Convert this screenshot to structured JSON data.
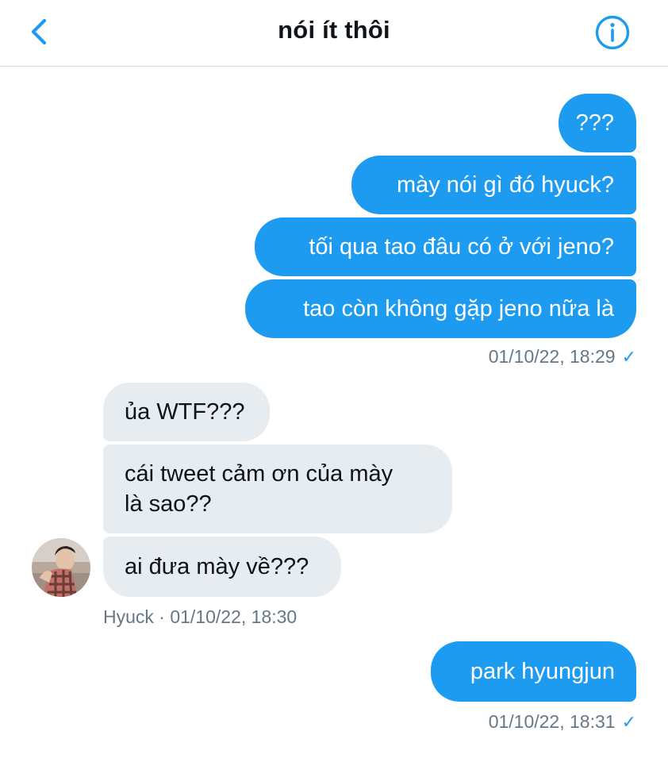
{
  "header": {
    "title": "nói ít thôi",
    "back_icon": "chevron-left-icon",
    "info_icon": "info-circle-icon"
  },
  "colors": {
    "accent": "#1d9bf0",
    "incoming_bubble": "#e6ecf0",
    "meta_text": "#657786"
  },
  "group1": {
    "messages": [
      "???",
      "mày nói gì đó hyuck?",
      "tối qua tao đâu có ở với jeno?",
      "tao còn không gặp jeno nữa là"
    ],
    "timestamp": "01/10/22, 18:29",
    "status_icon": "check-icon"
  },
  "group2": {
    "messages": [
      "ủa WTF???",
      "cái tweet cảm ơn của mày",
      "là sao??",
      "ai đưa mày về???"
    ],
    "meta": "Hyuck · 01/10/22, 18:30",
    "avatar_icon": "avatar"
  },
  "group3": {
    "messages": [
      "park hyungjun"
    ],
    "timestamp": "01/10/22, 18:31",
    "status_icon": "check-icon"
  }
}
